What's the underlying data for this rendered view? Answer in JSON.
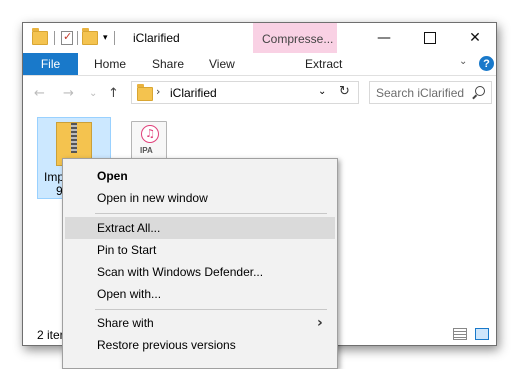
{
  "window": {
    "title": "iClarified",
    "contextual_tab_title": "Compresse...",
    "controls": {
      "minimize": "—",
      "maximize": "",
      "close": "✕"
    }
  },
  "ribbon": {
    "tabs": [
      "File",
      "Home",
      "Share",
      "View"
    ],
    "contextual_tab": "Extract",
    "collapse_icon": "⌄",
    "help": "?"
  },
  "addressbar": {
    "back": "←",
    "forward": "→",
    "recent": "⌄",
    "up": "↑",
    "path": "iClarified",
    "dropdown": "⌄",
    "refresh": "↻"
  },
  "search": {
    "placeholder": "Search iClarified"
  },
  "files": [
    {
      "label_line1": "Imp",
      "label_line2": "9.",
      "icon": "zip-folder-icon",
      "selected": true
    },
    {
      "icon": "ipa-file-icon",
      "icon_text": "IPA"
    }
  ],
  "status": {
    "text": "2 iter"
  },
  "context_menu": {
    "items": [
      {
        "label": "Open",
        "bold": true
      },
      {
        "label": "Open in new window"
      },
      {
        "label": "Extract All...",
        "highlighted": true
      },
      {
        "label": "Pin to Start"
      },
      {
        "label": "Scan with Windows Defender..."
      },
      {
        "label": "Open with..."
      },
      {
        "label": "Share with",
        "submenu_arrow": "›"
      },
      {
        "label": "Restore previous versions"
      }
    ]
  }
}
